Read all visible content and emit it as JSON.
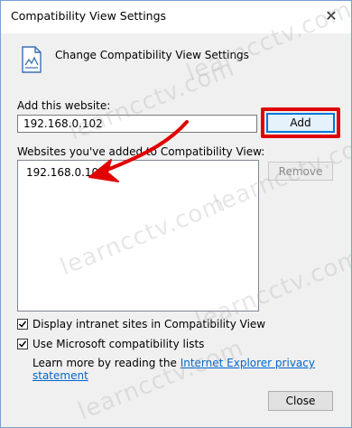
{
  "window": {
    "title": "Compatibility View Settings",
    "close_glyph": "✕"
  },
  "header": {
    "icon": "document-icon",
    "text": "Change Compatibility View Settings"
  },
  "add_site": {
    "label": "Add this website:",
    "value": "192.168.0.102",
    "button": "Add",
    "highlight_color": "#e00000"
  },
  "list": {
    "label": "Websites you've added to Compatibility View:",
    "items": [
      "192.168.0.102"
    ],
    "remove_button": "Remove"
  },
  "options": [
    {
      "label": "Display intranet sites in Compatibility View",
      "checked": true
    },
    {
      "label": "Use Microsoft compatibility lists",
      "checked": true
    }
  ],
  "learn_more": {
    "prefix": "Learn more by reading the ",
    "link": "Internet Explorer privacy statement"
  },
  "footer": {
    "close_button": "Close"
  },
  "watermark": "learncctv.com",
  "annotation": {
    "arrow_color": "#e00000"
  }
}
